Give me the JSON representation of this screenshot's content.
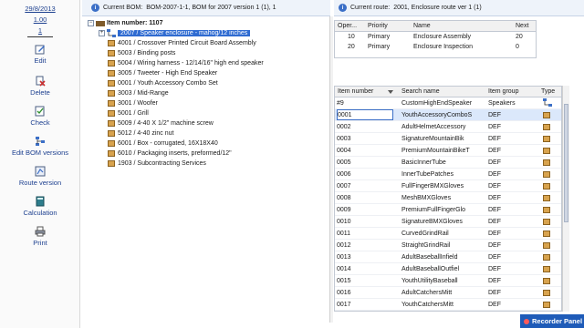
{
  "left_pane": {
    "date": "29/8/2013",
    "counter1": "1.00",
    "counter2": "1",
    "commands": [
      {
        "label": "Edit",
        "icon": "edit-icon"
      },
      {
        "label": "Delete",
        "icon": "delete-icon"
      },
      {
        "label": "Check",
        "icon": "check-icon"
      },
      {
        "label": "Edit BOM versions",
        "icon": "bom-versions-icon"
      },
      {
        "label": "Route version",
        "icon": "route-version-icon"
      },
      {
        "label": "Calculation",
        "icon": "calculation-icon"
      },
      {
        "label": "Print",
        "icon": "print-icon"
      }
    ]
  },
  "bom_header": {
    "prefix": "Current BOM:",
    "value": "BOM-2007-1-1, BOM for 2007 version 1 (1), 1"
  },
  "route_header": {
    "prefix": "Current route:",
    "value": "2001, Enclosure route ver 1 (1)"
  },
  "tree": {
    "root": "Item number: 1107",
    "selected": "2007 / Speaker enclosure - mahog/12 inches",
    "children": [
      "4001 / Crossover Printed Circuit Board Assembly",
      "5003 / Binding posts",
      "5004 / Wiring harness - 12/14/16\" high end speaker",
      "3005 / Tweeter - High End Speaker",
      "0001 / Youth Accessory Combo Set",
      "3003 / Mid-Range",
      "3001 / Woofer",
      "5001 / Grill",
      "5009 / 4-40 X 1/2\" machine screw",
      "5012 / 4-40 zinc nut",
      "6001 / Box - corrugated, 16X18X40",
      "6010 / Packaging inserts, preformed/12\"",
      "1903 / Subcontracting Services"
    ]
  },
  "operations": {
    "headers": [
      "Oper...",
      "Priority",
      "Name",
      "Next"
    ],
    "rows": [
      [
        "10",
        "Primary",
        "Enclosure Assembly",
        "20"
      ],
      [
        "20",
        "Primary",
        "Enclosure Inspection",
        "0"
      ]
    ]
  },
  "items": {
    "headers": [
      "Item number",
      "Search name",
      "Item group",
      "Type"
    ],
    "rows": [
      [
        "#9",
        "CustomHighEndSpeaker",
        "Speakers"
      ],
      [
        "0001",
        "YouthAccessoryComboS",
        "DEF"
      ],
      [
        "0002",
        "AdultHelmetAccessory",
        "DEF"
      ],
      [
        "0003",
        "SignatureMountainBik",
        "DEF"
      ],
      [
        "0004",
        "PremiumMountainBikeT",
        "DEF"
      ],
      [
        "0005",
        "BasicInnerTube",
        "DEF"
      ],
      [
        "0006",
        "InnerTubePatches",
        "DEF"
      ],
      [
        "0007",
        "FullFingerBMXGloves",
        "DEF"
      ],
      [
        "0008",
        "MeshBMXGloves",
        "DEF"
      ],
      [
        "0009",
        "PremiumFullFingerGlo",
        "DEF"
      ],
      [
        "0010",
        "SignatureBMXGloves",
        "DEF"
      ],
      [
        "0011",
        "CurvedGrindRail",
        "DEF"
      ],
      [
        "0012",
        "StraightGrindRail",
        "DEF"
      ],
      [
        "0013",
        "AdultBaseballInfield",
        "DEF"
      ],
      [
        "0014",
        "AdultBaseballOutfiel",
        "DEF"
      ],
      [
        "0015",
        "YouthUtilityBaseball",
        "DEF"
      ],
      [
        "0016",
        "AdultCatchersMitt",
        "DEF"
      ],
      [
        "0017",
        "YouthCatchersMitt",
        "DEF"
      ]
    ]
  },
  "recorder": {
    "label": "Recorder Panel"
  },
  "colors": {
    "accent": "#2f6bd1",
    "link": "#1c3f8f",
    "box": "#d8a34e"
  }
}
